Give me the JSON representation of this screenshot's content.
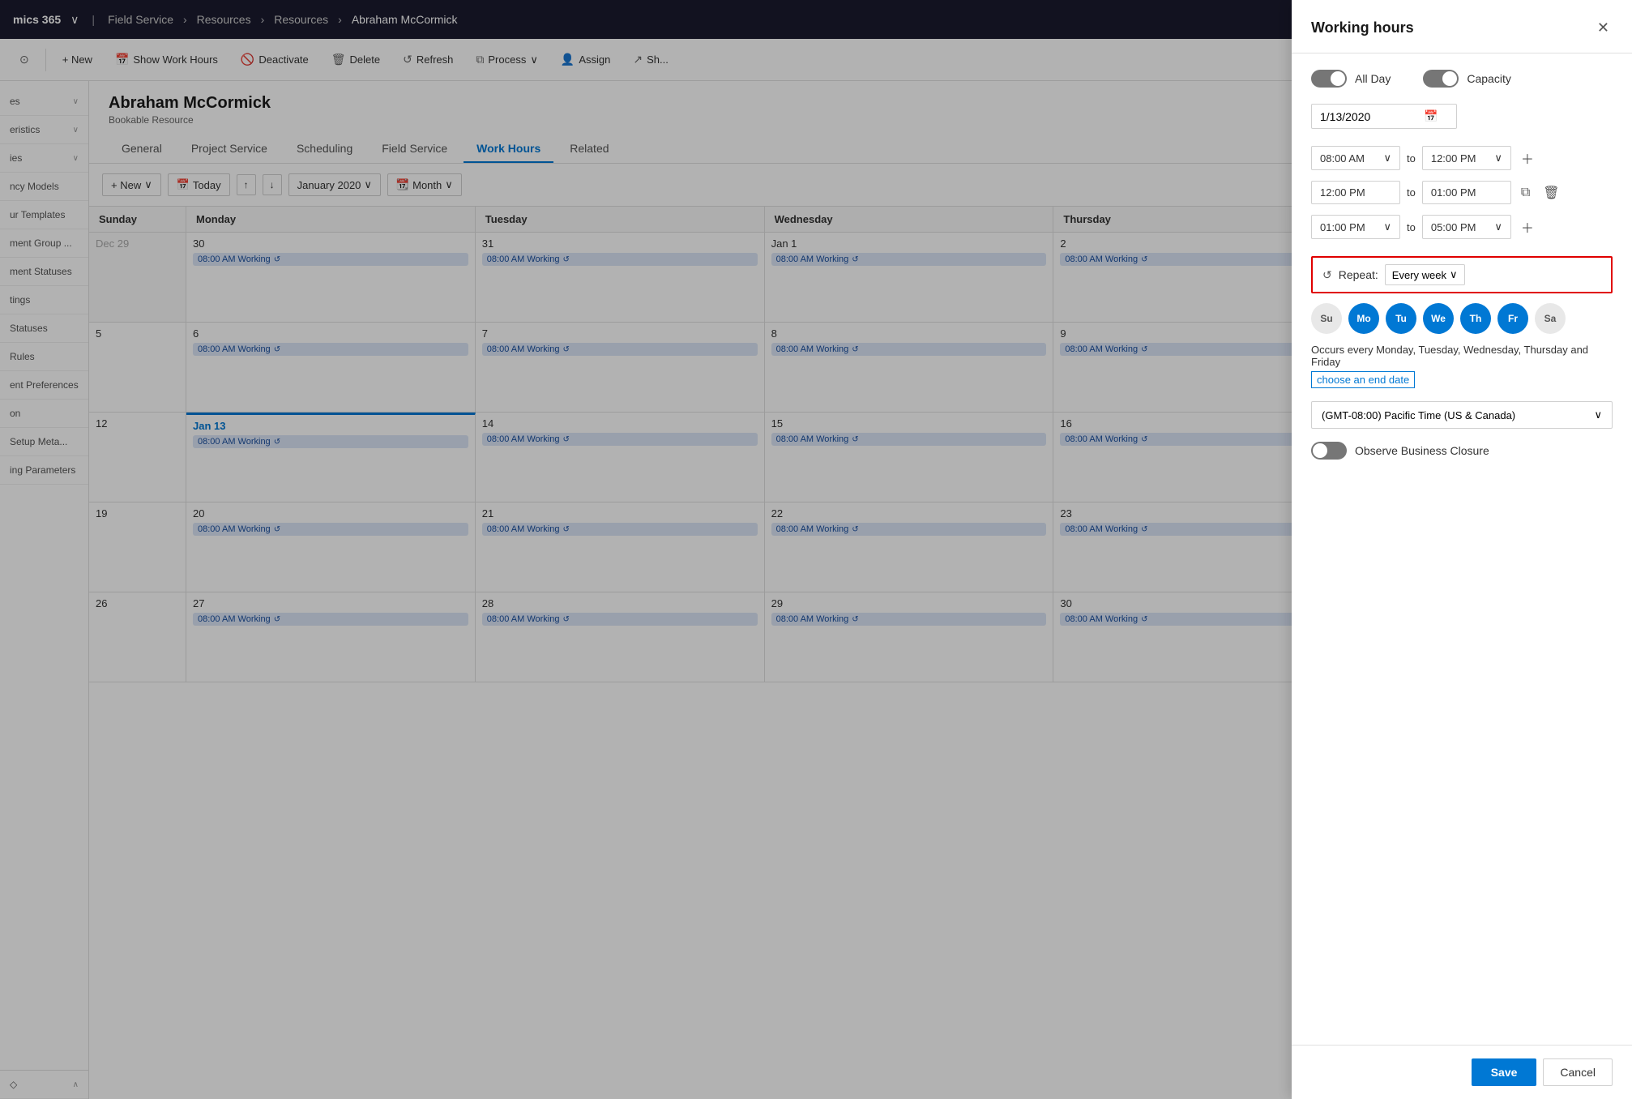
{
  "app": {
    "name": "mics 365",
    "chevron": "›",
    "nav": [
      "Field Service",
      "Resources",
      "Resources",
      "Abraham McCormick"
    ]
  },
  "commandBar": {
    "history_icon": "⊙",
    "new_label": "+ New",
    "show_work_hours_label": "Show Work Hours",
    "deactivate_label": "Deactivate",
    "delete_label": "Delete",
    "refresh_label": "Refresh",
    "process_label": "Process",
    "assign_label": "Assign",
    "share_label": "Sh..."
  },
  "sidebar": {
    "items": [
      {
        "label": "es",
        "has_chevron": true
      },
      {
        "label": "eristics",
        "has_chevron": true
      },
      {
        "label": "ies",
        "has_chevron": true
      },
      {
        "label": "ncy Models",
        "has_chevron": false
      },
      {
        "label": "ur Templates",
        "has_chevron": false
      },
      {
        "label": "ment Group ...",
        "has_chevron": false
      },
      {
        "label": "ment Statuses",
        "has_chevron": false
      },
      {
        "label": "tings",
        "has_chevron": false
      },
      {
        "label": "Statuses",
        "has_chevron": false
      },
      {
        "label": "Rules",
        "has_chevron": false
      },
      {
        "label": "ent Preferences",
        "has_chevron": false
      },
      {
        "label": "on",
        "has_chevron": false
      },
      {
        "label": "Setup Meta...",
        "has_chevron": false
      },
      {
        "label": "ing Parameters",
        "has_chevron": false
      }
    ]
  },
  "record": {
    "title": "Abraham McCormick",
    "subtitle": "Bookable Resource",
    "tabs": [
      "General",
      "Project Service",
      "Scheduling",
      "Field Service",
      "Work Hours",
      "Related"
    ],
    "active_tab": "Work Hours"
  },
  "calendar": {
    "new_label": "+ New",
    "today_label": "Today",
    "period_label": "January 2020",
    "month_label": "Month",
    "days": [
      "Sunday",
      "Monday",
      "Tuesday",
      "Wednesday",
      "Thursday"
    ],
    "weeks": [
      {
        "cells": [
          {
            "day": "Dec 29",
            "other_month": true,
            "has_event": false
          },
          {
            "day": "30",
            "other_month": false,
            "has_event": true,
            "event_text": "08:00 AM Working"
          },
          {
            "day": "31",
            "other_month": false,
            "has_event": true,
            "event_text": "08:00 AM Working"
          },
          {
            "day": "Jan 1",
            "other_month": false,
            "has_event": true,
            "event_text": "08:00 AM Working"
          },
          {
            "day": "2",
            "other_month": false,
            "has_event": true,
            "event_text": "08:00 AM Working"
          }
        ]
      },
      {
        "cells": [
          {
            "day": "5",
            "other_month": false,
            "has_event": false
          },
          {
            "day": "6",
            "other_month": false,
            "has_event": true,
            "event_text": "08:00 AM Working"
          },
          {
            "day": "7",
            "other_month": false,
            "has_event": true,
            "event_text": "08:00 AM Working"
          },
          {
            "day": "8",
            "other_month": false,
            "has_event": true,
            "event_text": "08:00 AM Working"
          },
          {
            "day": "9",
            "other_month": false,
            "has_event": true,
            "event_text": "08:00 AM Working"
          }
        ]
      },
      {
        "cells": [
          {
            "day": "12",
            "other_month": false,
            "has_event": false
          },
          {
            "day": "Jan 13",
            "other_month": false,
            "has_event": true,
            "event_text": "08:00 AM Working",
            "today": true
          },
          {
            "day": "14",
            "other_month": false,
            "has_event": true,
            "event_text": "08:00 AM Working"
          },
          {
            "day": "15",
            "other_month": false,
            "has_event": true,
            "event_text": "08:00 AM Working"
          },
          {
            "day": "16",
            "other_month": false,
            "has_event": true,
            "event_text": "08:00 AM Working"
          }
        ]
      },
      {
        "cells": [
          {
            "day": "19",
            "other_month": false,
            "has_event": false
          },
          {
            "day": "20",
            "other_month": false,
            "has_event": true,
            "event_text": "08:00 AM Working"
          },
          {
            "day": "21",
            "other_month": false,
            "has_event": true,
            "event_text": "08:00 AM Working"
          },
          {
            "day": "22",
            "other_month": false,
            "has_event": true,
            "event_text": "08:00 AM Working"
          },
          {
            "day": "23",
            "other_month": false,
            "has_event": true,
            "event_text": "08:00 AM Working"
          }
        ]
      },
      {
        "cells": [
          {
            "day": "26",
            "other_month": false,
            "has_event": false
          },
          {
            "day": "27",
            "other_month": false,
            "has_event": true,
            "event_text": "08:00 AM Working"
          },
          {
            "day": "28",
            "other_month": false,
            "has_event": true,
            "event_text": "08:00 AM Working"
          },
          {
            "day": "29",
            "other_month": false,
            "has_event": true,
            "event_text": "08:00 AM Working"
          },
          {
            "day": "30",
            "other_month": false,
            "has_event": true,
            "event_text": "08:00 AM Working"
          }
        ]
      }
    ]
  },
  "panel": {
    "title": "Working hours",
    "all_day_label": "All Day",
    "capacity_label": "Capacity",
    "date_value": "1/13/2020",
    "time_slots": [
      {
        "from": "08:00 AM",
        "to": "12:00 PM",
        "action": "add"
      },
      {
        "from": "12:00 PM",
        "to": "01:00 PM",
        "action": "delete",
        "has_copy": true
      },
      {
        "from": "01:00 PM",
        "to": "05:00 PM",
        "action": "add"
      }
    ],
    "repeat_label": "Repeat:",
    "repeat_value": "Every week",
    "day_circles": [
      {
        "label": "Su",
        "active": false
      },
      {
        "label": "Mo",
        "active": true
      },
      {
        "label": "Tu",
        "active": true
      },
      {
        "label": "We",
        "active": true
      },
      {
        "label": "Th",
        "active": true
      },
      {
        "label": "Fr",
        "active": true
      },
      {
        "label": "Sa",
        "active": false
      }
    ],
    "occurrence_text": "Occurs every Monday, Tuesday, Wednesday, Thursday and Friday",
    "choose_end_date_label": "choose an end date",
    "timezone_label": "(GMT-08:00) Pacific Time (US & Canada)",
    "observe_closure_label": "Observe Business Closure",
    "save_label": "Save",
    "cancel_label": "Cancel"
  }
}
